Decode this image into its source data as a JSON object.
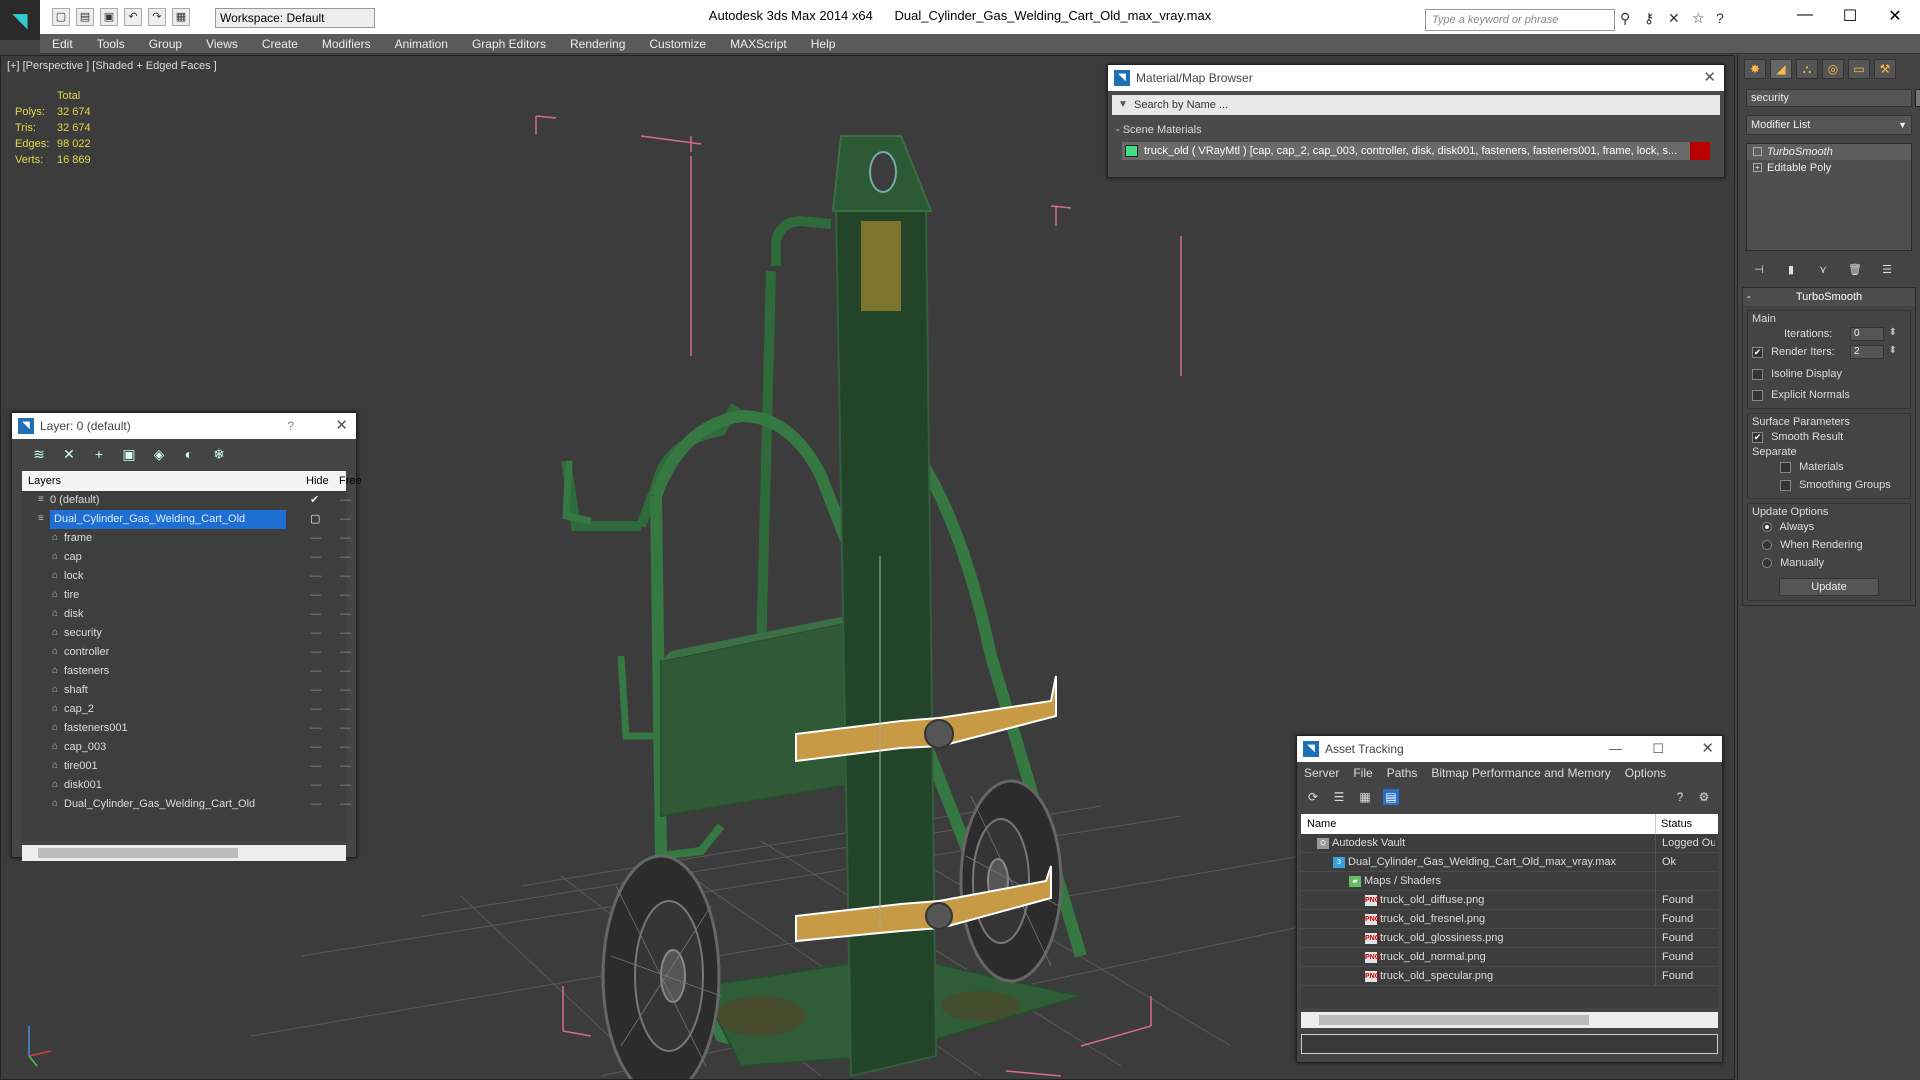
{
  "app": {
    "name": "Autodesk 3ds Max  2014 x64",
    "file": "Dual_Cylinder_Gas_Welding_Cart_Old_max_vray.max",
    "workspace": "Workspace: Default",
    "search_placeholder": "Type a keyword or phrase"
  },
  "menu": [
    "Edit",
    "Tools",
    "Group",
    "Views",
    "Create",
    "Modifiers",
    "Animation",
    "Graph Editors",
    "Rendering",
    "Customize",
    "MAXScript",
    "Help"
  ],
  "viewport": {
    "label": "[+] [Perspective ] [Shaded + Edged Faces ]",
    "stats": {
      "header": "Total",
      "rows": [
        {
          "k": "Polys:",
          "v": "32 674"
        },
        {
          "k": "Tris:",
          "v": "32 674"
        },
        {
          "k": "Edges:",
          "v": "98 022"
        },
        {
          "k": "Verts:",
          "v": "16 869"
        }
      ]
    }
  },
  "layer_window": {
    "title": "Layer: 0 (default)",
    "help": "?",
    "columns": {
      "layers": "Layers",
      "hide": "Hide",
      "freeze": "Free"
    },
    "rows": [
      {
        "name": "0 (default)",
        "level": 0,
        "type": "layer",
        "current": true
      },
      {
        "name": "Dual_Cylinder_Gas_Welding_Cart_Old",
        "level": 0,
        "type": "layer",
        "selected": true
      },
      {
        "name": "frame",
        "level": 1,
        "type": "object"
      },
      {
        "name": "cap",
        "level": 1,
        "type": "object"
      },
      {
        "name": "lock",
        "level": 1,
        "type": "object"
      },
      {
        "name": "tire",
        "level": 1,
        "type": "object"
      },
      {
        "name": "disk",
        "level": 1,
        "type": "object"
      },
      {
        "name": "security",
        "level": 1,
        "type": "object"
      },
      {
        "name": "controller",
        "level": 1,
        "type": "object"
      },
      {
        "name": "fasteners",
        "level": 1,
        "type": "object"
      },
      {
        "name": "shaft",
        "level": 1,
        "type": "object"
      },
      {
        "name": "cap_2",
        "level": 1,
        "type": "object"
      },
      {
        "name": "fasteners001",
        "level": 1,
        "type": "object"
      },
      {
        "name": "cap_003",
        "level": 1,
        "type": "object"
      },
      {
        "name": "tire001",
        "level": 1,
        "type": "object"
      },
      {
        "name": "disk001",
        "level": 1,
        "type": "object"
      },
      {
        "name": "Dual_Cylinder_Gas_Welding_Cart_Old",
        "level": 1,
        "type": "object"
      }
    ]
  },
  "material_browser": {
    "title": "Material/Map Browser",
    "search_placeholder": "Search by Name ...",
    "group": "- Scene Materials",
    "item": "truck_old ( VRayMtl ) [cap, cap_2, cap_003, controller, disk, disk001, fasteners, fasteners001, frame, lock, s..."
  },
  "command_panel": {
    "object_name": "security",
    "modifier_list": "Modifier List",
    "stack": [
      {
        "name": "TurboSmooth",
        "active": true
      },
      {
        "name": "Editable Poly",
        "active": false
      }
    ],
    "rollout_title": "TurboSmooth",
    "main": {
      "label": "Main",
      "iterations_label": "Iterations:",
      "iterations": "0",
      "render_iters_label": "Render Iters:",
      "render_iters": "2",
      "isoline": "Isoline Display",
      "explicit": "Explicit Normals"
    },
    "surface": {
      "label": "Surface Parameters",
      "smooth": "Smooth Result",
      "separate": "Separate",
      "materials": "Materials",
      "smoothing_groups": "Smoothing Groups"
    },
    "update": {
      "label": "Update Options",
      "always": "Always",
      "when_rendering": "When Rendering",
      "manually": "Manually",
      "button": "Update"
    }
  },
  "asset_tracking": {
    "title": "Asset Tracking",
    "menu": [
      "Server",
      "File",
      "Paths",
      "Bitmap Performance and Memory",
      "Options"
    ],
    "columns": {
      "name": "Name",
      "status": "Status"
    },
    "rows": [
      {
        "name": "Autodesk Vault",
        "status": "Logged Ou",
        "indent": 1,
        "icon": "vault"
      },
      {
        "name": "Dual_Cylinder_Gas_Welding_Cart_Old_max_vray.max",
        "status": "Ok",
        "indent": 2,
        "icon": "max"
      },
      {
        "name": "Maps / Shaders",
        "status": "",
        "indent": 3,
        "icon": "folder"
      },
      {
        "name": "truck_old_diffuse.png",
        "status": "Found",
        "indent": 4,
        "icon": "png"
      },
      {
        "name": "truck_old_fresnel.png",
        "status": "Found",
        "indent": 4,
        "icon": "png"
      },
      {
        "name": "truck_old_glossiness.png",
        "status": "Found",
        "indent": 4,
        "icon": "png"
      },
      {
        "name": "truck_old_normal.png",
        "status": "Found",
        "indent": 4,
        "icon": "png"
      },
      {
        "name": "truck_old_specular.png",
        "status": "Found",
        "indent": 4,
        "icon": "png"
      }
    ]
  },
  "colors": {
    "selection": "#1f6ed4",
    "stats": "#e0d84c",
    "cart_green": "#2f6a3a",
    "bbox": "#e06a9a"
  }
}
